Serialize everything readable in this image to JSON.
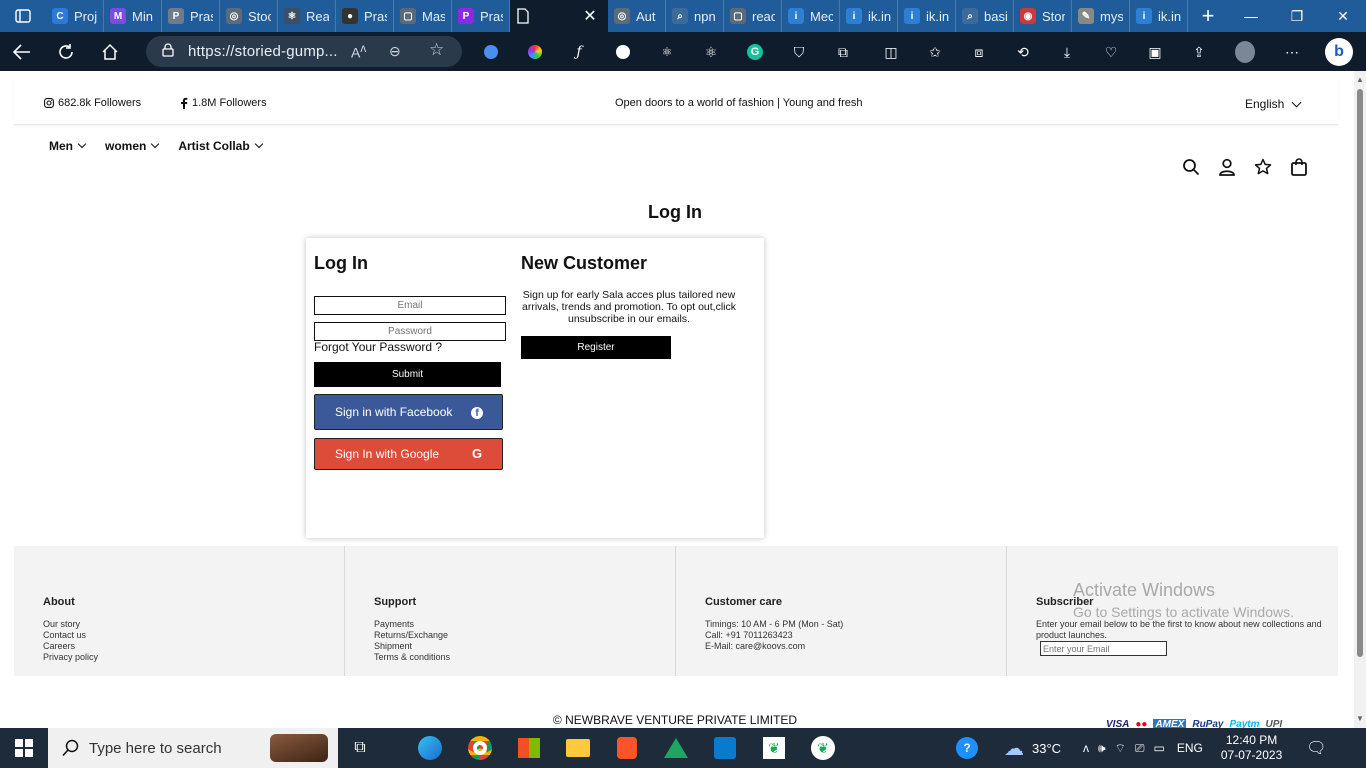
{
  "browser": {
    "tabs": [
      {
        "title": "Proj",
        "color": "#2b7bd6",
        "glyph": "C"
      },
      {
        "title": "Min",
        "color": "#7a4de0",
        "glyph": "M"
      },
      {
        "title": "Pras",
        "color": "#6d7b8a",
        "glyph": "P"
      },
      {
        "title": "Stoc",
        "color": "#5c6b7a",
        "glyph": "◎"
      },
      {
        "title": "Rea",
        "color": "#3c4e63",
        "glyph": "⚛"
      },
      {
        "title": "Pras",
        "color": "#333333",
        "glyph": "●"
      },
      {
        "title": "Mas",
        "color": "#5a6a7b",
        "glyph": "▢"
      },
      {
        "title": "Pras",
        "color": "#8a2be2",
        "glyph": "P"
      },
      {
        "title": "Aut",
        "color": "#5c6b7a",
        "glyph": "◎"
      },
      {
        "title": "npn",
        "color": "#3c6a99",
        "glyph": "⌕"
      },
      {
        "title": "reac",
        "color": "#5a6a7b",
        "glyph": "▢"
      },
      {
        "title": "Mec",
        "color": "#2d7fd3",
        "glyph": "i"
      },
      {
        "title": "ik.in",
        "color": "#2d7fd3",
        "glyph": "i"
      },
      {
        "title": "ik.in",
        "color": "#2d7fd3",
        "glyph": "i"
      },
      {
        "title": "basi",
        "color": "#3c6a99",
        "glyph": "⌕"
      },
      {
        "title": "Stor",
        "color": "#c93a3a",
        "glyph": "◉"
      },
      {
        "title": "mys",
        "color": "#888888",
        "glyph": "✎"
      },
      {
        "title": "ik.in",
        "color": "#2d7fd3",
        "glyph": "i"
      }
    ],
    "url": "https://storied-gump...",
    "accent": "#1f5c99",
    "toolbar_bg": "#0f1c2b"
  },
  "site": {
    "instagram_followers": "682.8k Followers",
    "facebook_followers": "1.8M Followers",
    "tagline": "Open doors to a world of fashion | Young and fresh",
    "language": "English",
    "nav": [
      {
        "label": "Men"
      },
      {
        "label": "women"
      },
      {
        "label": "Artist Collab"
      }
    ],
    "header_icons": [
      "search-icon",
      "user-icon",
      "star-icon",
      "bag-icon"
    ]
  },
  "login": {
    "page_title": "Log In",
    "heading": "Log In",
    "email_placeholder": "Email",
    "password_placeholder": "Password",
    "forgot": "Forgot Your Password ?",
    "submit": "Submit",
    "facebook": "Sign in with Facebook",
    "google": "Sign In with Google",
    "facebook_color": "#3b5998",
    "google_color": "#dd4b39"
  },
  "new_customer": {
    "heading": "New Customer",
    "text": "Sign up for early Sala acces plus tailored new arrivals, trends and promotion. To opt out,click unsubscribe in our emails.",
    "register": "Register"
  },
  "footer": {
    "about": {
      "title": "About",
      "links": [
        "Our story",
        "Contact us",
        "Careers",
        "Privacy policy"
      ]
    },
    "support": {
      "title": "Support",
      "links": [
        "Payments",
        "Returns/Exchange",
        "Shipment",
        "Terms & conditions"
      ]
    },
    "care": {
      "title": "Customer care",
      "lines": [
        "Timings: 10 AM - 6 PM (Mon - Sat)",
        "Call: +91 7011263423",
        "E-Mail: care@koovs.com"
      ]
    },
    "subscriber": {
      "title": "Subscriber",
      "text": "Enter your email below to be the first to know about new collections and product launches.",
      "placeholder": "Enter your Email"
    },
    "copyright": "© NEWBRAVE VENTURE PRIVATE LIMITED",
    "payments": [
      "VISA",
      "●●",
      "AMEX",
      "RuPay",
      "Paytm",
      "UPI"
    ]
  },
  "windows": {
    "activate_title": "Activate Windows",
    "activate_sub": "Go to Settings to activate Windows.",
    "search_placeholder": "Type here to search",
    "temperature": "33°C",
    "language": "ENG",
    "time": "12:40 PM",
    "date": "07-07-2023"
  }
}
